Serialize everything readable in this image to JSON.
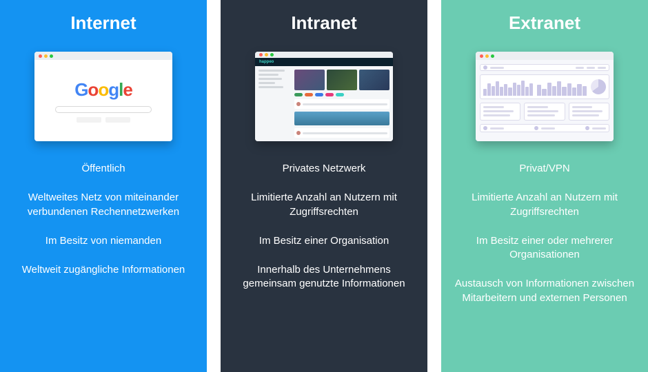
{
  "columns": [
    {
      "key": "internet",
      "title": "Internet",
      "features": [
        "Öffentlich",
        "Weltweites Netz von miteinander verbundenen Rechennetzwerken",
        "Im Besitz von niemanden",
        "Weltweit zugängliche Informationen"
      ]
    },
    {
      "key": "intranet",
      "title": "Intranet",
      "features": [
        "Privates Netzwerk",
        "Limitierte Anzahl an Nutzern mit Zugriffsrechten",
        "Im Besitz einer Organisation",
        "Innerhalb des Unternehmens gemeinsam genutzte Informationen"
      ]
    },
    {
      "key": "extranet",
      "title": "Extranet",
      "features": [
        "Privat/VPN",
        "Limitierte Anzahl an Nutzern mit Zugriffsrechten",
        "Im Besitz einer oder mehrerer Organisationen",
        "Austausch von Informationen zwischen Mitarbeitern und externen Personen"
      ]
    }
  ],
  "mock": {
    "google_logo": "Google",
    "intranet_brand": "happeo"
  },
  "colors": {
    "internet": "#1493f2",
    "intranet": "#293340",
    "extranet": "#6bccb2"
  }
}
